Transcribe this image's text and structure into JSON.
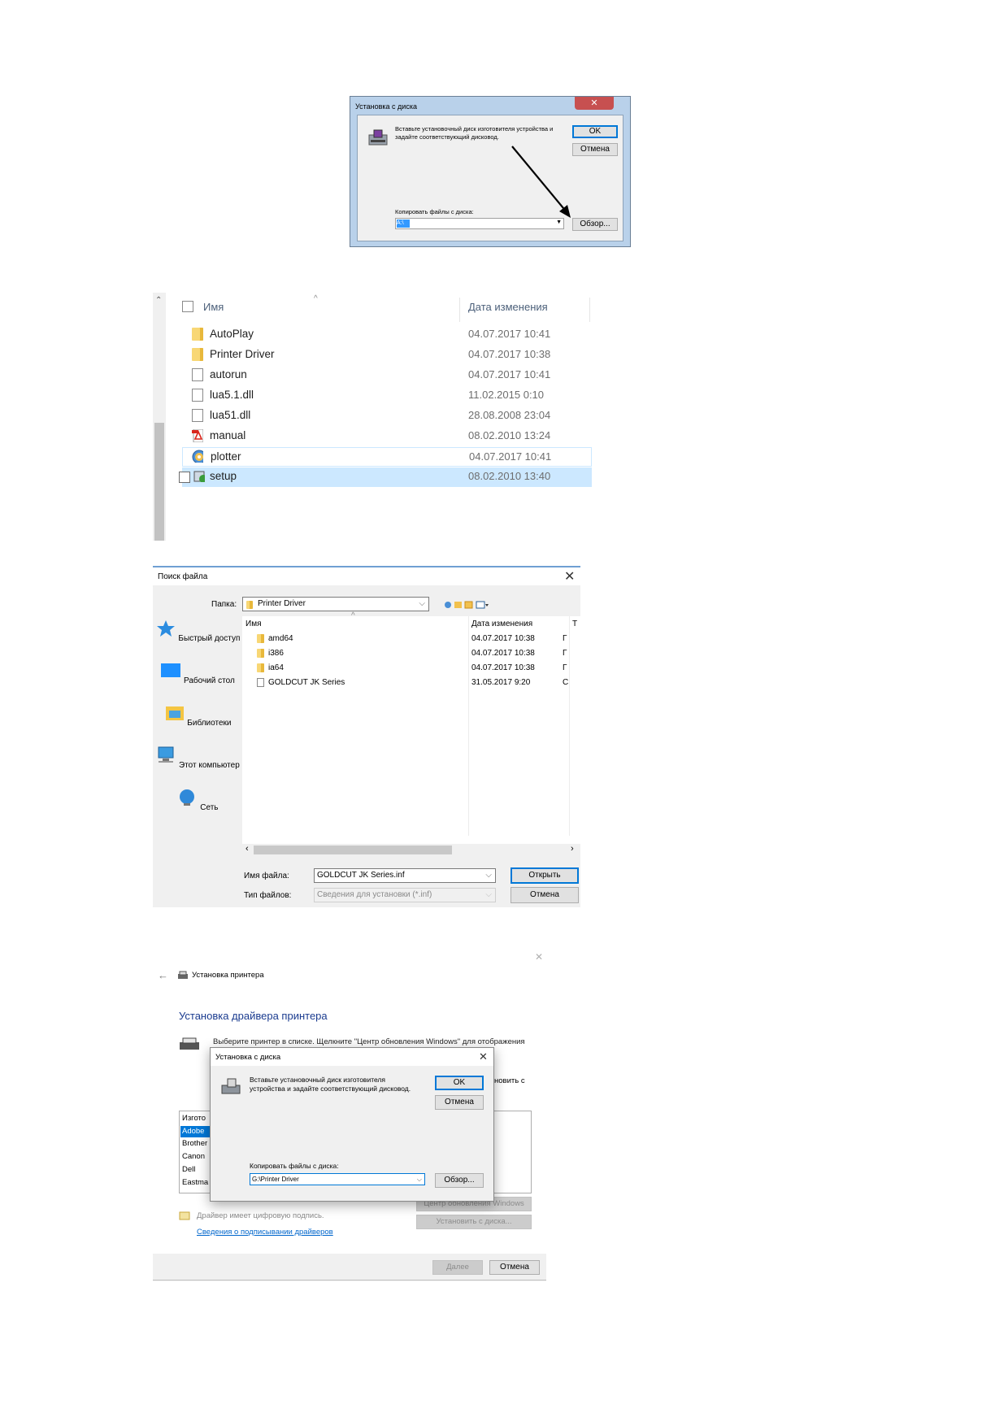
{
  "screen1": {
    "title": "Установка с диска",
    "close": "✕",
    "message": "Вставьте установочный диск изготовителя устройства и задайте соответствующий дисковод.",
    "ok_label": "OK",
    "cancel_label": "Отмена",
    "copy_label": "Копировать файлы с диска:",
    "combo_value": "A:\\",
    "browse_label": "Обзор..."
  },
  "screen2": {
    "col_name": "Имя",
    "col_date": "Дата изменения",
    "rows": [
      {
        "name": "AutoPlay",
        "date": "04.07.2017 10:41",
        "icon": "folder-icon"
      },
      {
        "name": "Printer Driver",
        "date": "04.07.2017 10:38",
        "icon": "folder-icon"
      },
      {
        "name": "autorun",
        "date": "04.07.2017 10:41",
        "icon": "file-icon"
      },
      {
        "name": "lua5.1.dll",
        "date": "11.02.2015 0:10",
        "icon": "dll-icon"
      },
      {
        "name": "lua51.dll",
        "date": "28.08.2008 23:04",
        "icon": "dll-icon"
      },
      {
        "name": "manual",
        "date": "08.02.2010 13:24",
        "icon": "pdf-icon"
      },
      {
        "name": "plotter",
        "date": "04.07.2017 10:41",
        "icon": "disc-icon"
      },
      {
        "name": "setup",
        "date": "08.02.2010 13:40",
        "icon": "setup-icon"
      }
    ]
  },
  "screen3": {
    "title": "Поиск файла",
    "close": "✕",
    "folder_label": "Папка:",
    "folder_value": "Printer Driver",
    "places": [
      "Быстрый доступ",
      "Рабочий стол",
      "Библиотеки",
      "Этот компьютер",
      "Сеть"
    ],
    "col_name": "Имя",
    "col_date": "Дата изменения",
    "col_type": "Т",
    "rows": [
      {
        "name": "amd64",
        "date": "04.07.2017 10:38",
        "type": "Г"
      },
      {
        "name": "i386",
        "date": "04.07.2017 10:38",
        "type": "Г"
      },
      {
        "name": "ia64",
        "date": "04.07.2017 10:38",
        "type": "Г"
      },
      {
        "name": "GOLDCUT JK Series",
        "date": "31.05.2017 9:20",
        "type": "С"
      }
    ],
    "filename_label": "Имя файла:",
    "filename_value": "GOLDCUT JK Series.inf",
    "filetype_label": "Тип файлов:",
    "filetype_value": "Сведения для установки (*.inf)",
    "open_label": "Открыть",
    "cancel_label": "Отмена"
  },
  "screen4": {
    "back": "←",
    "window_title": "Установка принтера",
    "close": "✕",
    "heading": "Установка драйвера принтера",
    "description": "Выберите принтер в списке. Щелкните \"Центр обновления Windows\" для отображения",
    "description_tail": "новить с",
    "list_header": "Изгото",
    "list_items": [
      "Adobe",
      "Brother",
      "Canon",
      "Dell",
      "Eastma"
    ],
    "signed_text": "Драйвер имеет цифровую подпись.",
    "signing_link": "Сведения о подписывании драйверов",
    "windows_update_label": "Центр обновления Windows",
    "have_disk_label": "Установить с диска...",
    "next_label": "Далее",
    "cancel_label": "Отмена",
    "dialog": {
      "title": "Установка с диска",
      "close": "✕",
      "message": "Вставьте установочный диск изготовителя устройства и задайте соответствующий дисковод.",
      "ok_label": "OK",
      "cancel_label": "Отмена",
      "copy_label": "Копировать файлы с диска:",
      "combo_value": "G:\\Printer Driver",
      "browse_label": "Обзор..."
    }
  }
}
